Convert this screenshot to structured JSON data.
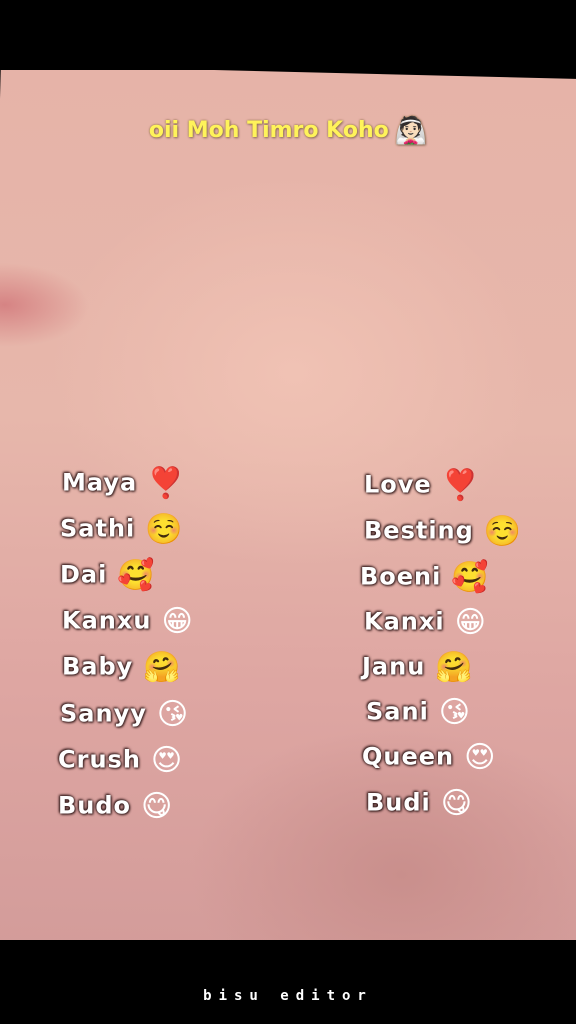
{
  "title": {
    "text": "oii Moh Timro Koho",
    "emoji": "👰🏻"
  },
  "left_list": [
    {
      "name": "Maya",
      "emoji": "❣️"
    },
    {
      "name": "Sathi",
      "emoji": "☺️"
    },
    {
      "name": "Dai",
      "emoji": "🥰"
    },
    {
      "name": "Kanxu",
      "emoji": "😁"
    },
    {
      "name": "Baby",
      "emoji": "🤗"
    },
    {
      "name": "Sanyy",
      "emoji": "😘"
    },
    {
      "name": "Crush",
      "emoji": "😍"
    },
    {
      "name": "Budo",
      "emoji": "😋"
    }
  ],
  "right_list": [
    {
      "name": "Love",
      "emoji": "❣️"
    },
    {
      "name": "Besting",
      "emoji": "☺️"
    },
    {
      "name": "Boeni",
      "emoji": "🥰"
    },
    {
      "name": "Kanxi",
      "emoji": "😁"
    },
    {
      "name": "Janu",
      "emoji": "🤗"
    },
    {
      "name": "Sani",
      "emoji": "😘"
    },
    {
      "name": "Queen",
      "emoji": "😍"
    },
    {
      "name": "Budi",
      "emoji": "😋"
    }
  ],
  "footer": {
    "text": "bisu editor"
  }
}
